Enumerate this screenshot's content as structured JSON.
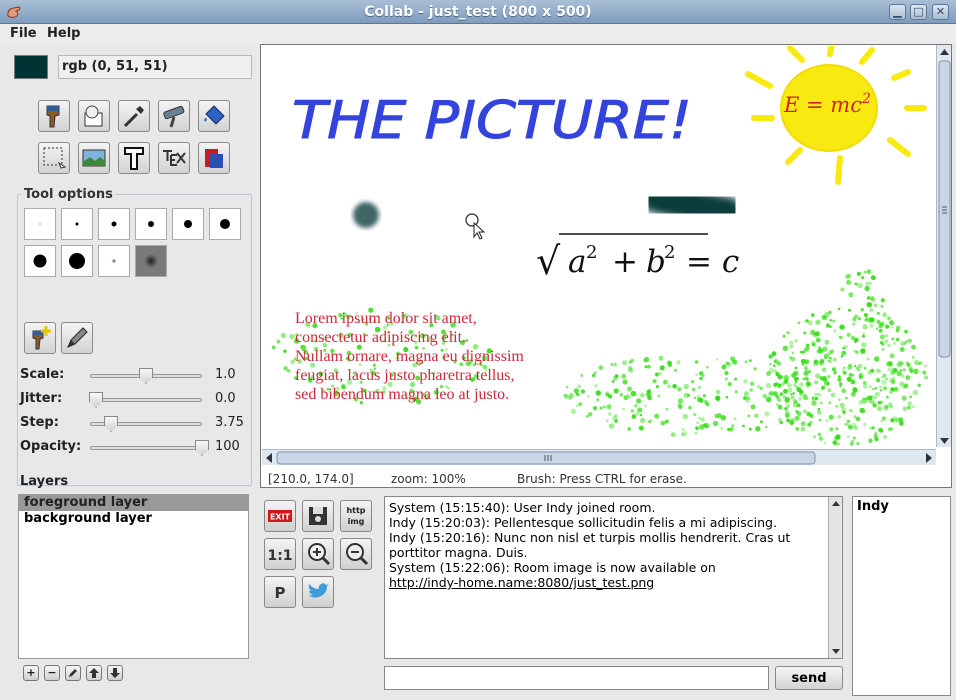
{
  "window": {
    "title": "Collab - just_test (800 x 500)"
  },
  "menu": {
    "file": "File",
    "help": "Help"
  },
  "color": {
    "value": "#003333",
    "label": "rgb (0, 51, 51)"
  },
  "tool_options": {
    "title": "Tool options"
  },
  "sliders": [
    {
      "label": "Scale:",
      "value": "1.0",
      "fraction": 0.45
    },
    {
      "label": "Jitter:",
      "value": "0.0",
      "fraction": 0.0
    },
    {
      "label": "Step:",
      "value": "3.75",
      "fraction": 0.16
    },
    {
      "label": "Opacity:",
      "value": "100",
      "fraction": 1.0
    }
  ],
  "layers": {
    "title": "Layers",
    "items": [
      "foreground layer",
      "background layer"
    ]
  },
  "layer_buttons": {
    "add": "+",
    "remove": "−"
  },
  "canvas": {
    "heading": "THE PICTURE!",
    "sun_formula": {
      "base": "E = mc",
      "exp": "2"
    },
    "formula": {
      "root": "√",
      "a": "a",
      "b": "b",
      "exp": "2",
      "plus": "+",
      "eq": "= c"
    },
    "lorem": [
      "Lorem ipsum dolor sit amet,",
      "consectetur adipiscing elit.",
      "Nullam ornare, magna eu dignissim",
      "feugiat, lacus justo pharetra tellus,",
      "sed bibendum magna leo at justo."
    ],
    "colors": {
      "heading": "#3344dd",
      "sun": "#f8ea10",
      "formula_red": "#cc2222",
      "lorem": "#cc2a3a",
      "spray": "#33dd11"
    }
  },
  "status": {
    "coords": "[210.0, 174.0]",
    "zoom": "zoom: 100%",
    "hint": "Brush: Press CTRL for erase."
  },
  "chat": {
    "buttons": {
      "exit": "EXIT",
      "http_1": "http",
      "http_2": "img",
      "one_to_one": "1:1",
      "p": "P"
    },
    "messages": [
      "System (15:15:40): User Indy joined room.",
      "Indy (15:20:03): Pellentesque sollicitudin felis a mi adipiscing.",
      "Indy (15:20:16): Nunc non nisl et turpis mollis hendrerit. Cras ut",
      "porttitor magna. Duis.",
      "System (15:22:06): Room image is now available on"
    ],
    "link": "http://indy-home.name:8080/just_test.png",
    "users": [
      "Indy"
    ],
    "send": "send",
    "input_value": ""
  }
}
